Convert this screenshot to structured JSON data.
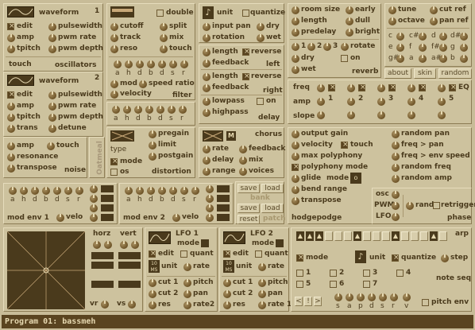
{
  "osc1": {
    "num": "1",
    "wave": "waveform",
    "edit": "edit",
    "amp": "amp",
    "tpitch": "tpitch",
    "pulsewidth": "pulsewidth",
    "pwm_rate": "pwm rate",
    "pwm_depth": "pwm depth",
    "touch": "touch",
    "title": "oscillators"
  },
  "osc2": {
    "num": "2",
    "wave": "waveform",
    "edit": "edit",
    "amp": "amp",
    "tpitch": "tpitch",
    "trans": "trans",
    "pulsewidth": "pulsewidth",
    "pwm_rate": "pwm rate",
    "pwm_depth": "pwm depth",
    "detune": "detune"
  },
  "noise": {
    "amp": "amp",
    "touch": "touch",
    "resonance": "resonance",
    "transpose": "transpose",
    "title": "noise"
  },
  "filter": {
    "double": "double",
    "cutoff": "cutoff",
    "split": "split",
    "track": "track",
    "mix": "mix",
    "reso": "reso",
    "touch": "touch",
    "env": [
      "a",
      "h",
      "d",
      "b",
      "d",
      "s",
      "r"
    ],
    "mod": "mod",
    "speed_ratio": "speed ratio",
    "velocity": "velocity",
    "title": "filter"
  },
  "fenv2": {
    "env": [
      "a",
      "h",
      "d",
      "b",
      "d",
      "s",
      "r"
    ]
  },
  "unit": {
    "unit": "unit",
    "quantize": "quantize",
    "input_pan": "input pan",
    "dry": "dry",
    "rotation": "rotation",
    "wet": "wet"
  },
  "delay": {
    "length1": "length",
    "reverse1": "reverse",
    "feedback1": "feedback",
    "left": "left",
    "length2": "length",
    "reverse2": "reverse",
    "feedback2": "feedback",
    "right": "right",
    "lowpass": "lowpass",
    "on": "on",
    "highpass": "highpass",
    "title": "delay"
  },
  "reverb": {
    "room_size": "room size",
    "early": "early",
    "length": "length",
    "dull": "dull",
    "predelay": "predelay",
    "bright": "bright",
    "n1": "1",
    "n2": "2",
    "n3": "3",
    "rotate": "rotate",
    "dry": "dry",
    "on": "on",
    "wet": "wet",
    "title": "reverb"
  },
  "tune": {
    "tune": "tune",
    "cut_ref": "cut ref",
    "octave": "octave",
    "pan_ref": "pan ref",
    "notes": [
      "c",
      "c#",
      "d",
      "d#",
      "e",
      "f",
      "f#",
      "g",
      "g#",
      "a",
      "a#",
      "b"
    ],
    "about": "about",
    "skin": "skin",
    "random": "random"
  },
  "eq": {
    "title": "EQ",
    "freq": "freq",
    "amp": "amp",
    "slope": "slope",
    "bands": [
      "1",
      "2",
      "3",
      "4",
      "5"
    ]
  },
  "distortion": {
    "pregain": "pregain",
    "limit": "limit",
    "postgain": "postgain",
    "type": "type",
    "mode": "mode",
    "os": "os",
    "title": "distortion",
    "logo": "Oatmeal"
  },
  "chorus": {
    "title": "chorus",
    "rate": "rate",
    "feedback": "feedback",
    "delay": "delay",
    "mix": "mix",
    "range": "range",
    "voices": "voices",
    "m": "M"
  },
  "hodge": {
    "output_gain": "output gain",
    "velocity": "velocity",
    "touch": "touch",
    "max_polyphony": "max polyphony",
    "polyphony_mode": "polyphony mode",
    "glide": "glide",
    "mode": "mode",
    "bend_range": "bend range",
    "transpose": "transpose",
    "random_pan": "random pan",
    "freq_pan": "freq > pan",
    "freq_env_speed": "freq > env speed",
    "random_freq": "random freq",
    "random_amp": "random amp",
    "title": "hodgepodge",
    "o": "o"
  },
  "phase": {
    "osc": "osc",
    "pwm": "PWM",
    "lfo": "LFO",
    "rand": "rand",
    "retrigger": "retrigger",
    "title": "phase"
  },
  "modenv1": {
    "env": [
      "a",
      "h",
      "d",
      "b",
      "d",
      "s",
      "r"
    ],
    "velo": "velo",
    "title": "mod env 1"
  },
  "modenv2": {
    "env": [
      "a",
      "h",
      "d",
      "b",
      "d",
      "s",
      "r"
    ],
    "velo": "velo",
    "title": "mod env 2"
  },
  "bank": {
    "save": "save",
    "load": "load",
    "bank": "bank",
    "save2": "save",
    "load2": "load",
    "reset": "reset",
    "patch": "patch"
  },
  "xy": {
    "horz": "horz",
    "vert": "vert",
    "vr": "vr",
    "vs": "vs"
  },
  "lfo1": {
    "title": "LFO 1",
    "mode": "mode",
    "edit": "edit",
    "quant": "quant",
    "unit": "unit",
    "rate": "rate",
    "ms": "10 MS",
    "cut1": "cut 1",
    "pitch": "pitch",
    "cut2": "cut 2",
    "pan": "pan",
    "res": "res",
    "rate2": "rate2"
  },
  "lfo2": {
    "title": "LFO 2",
    "mode": "mode",
    "edit": "edit",
    "quant": "quant",
    "unit": "unit",
    "rate": "rate",
    "ms": "10 MS",
    "cut1": "cut 1",
    "pitch": "pitch",
    "cut2": "cut 2",
    "pan": "pan",
    "res": "res",
    "rate1": "rate 1"
  },
  "arp": {
    "title": "arp",
    "mode": "mode",
    "unit": "unit",
    "quantize": "quantize",
    "step": "step",
    "seq": [
      "1",
      "2",
      "3",
      "4",
      "5",
      "6",
      "7"
    ],
    "note_seq": "note seq",
    "env": [
      "s",
      "a",
      "p",
      "d",
      "s",
      "r",
      "v"
    ],
    "pitch_env": "pitch env"
  },
  "status": {
    "text": "Program  01: bassmeh"
  }
}
